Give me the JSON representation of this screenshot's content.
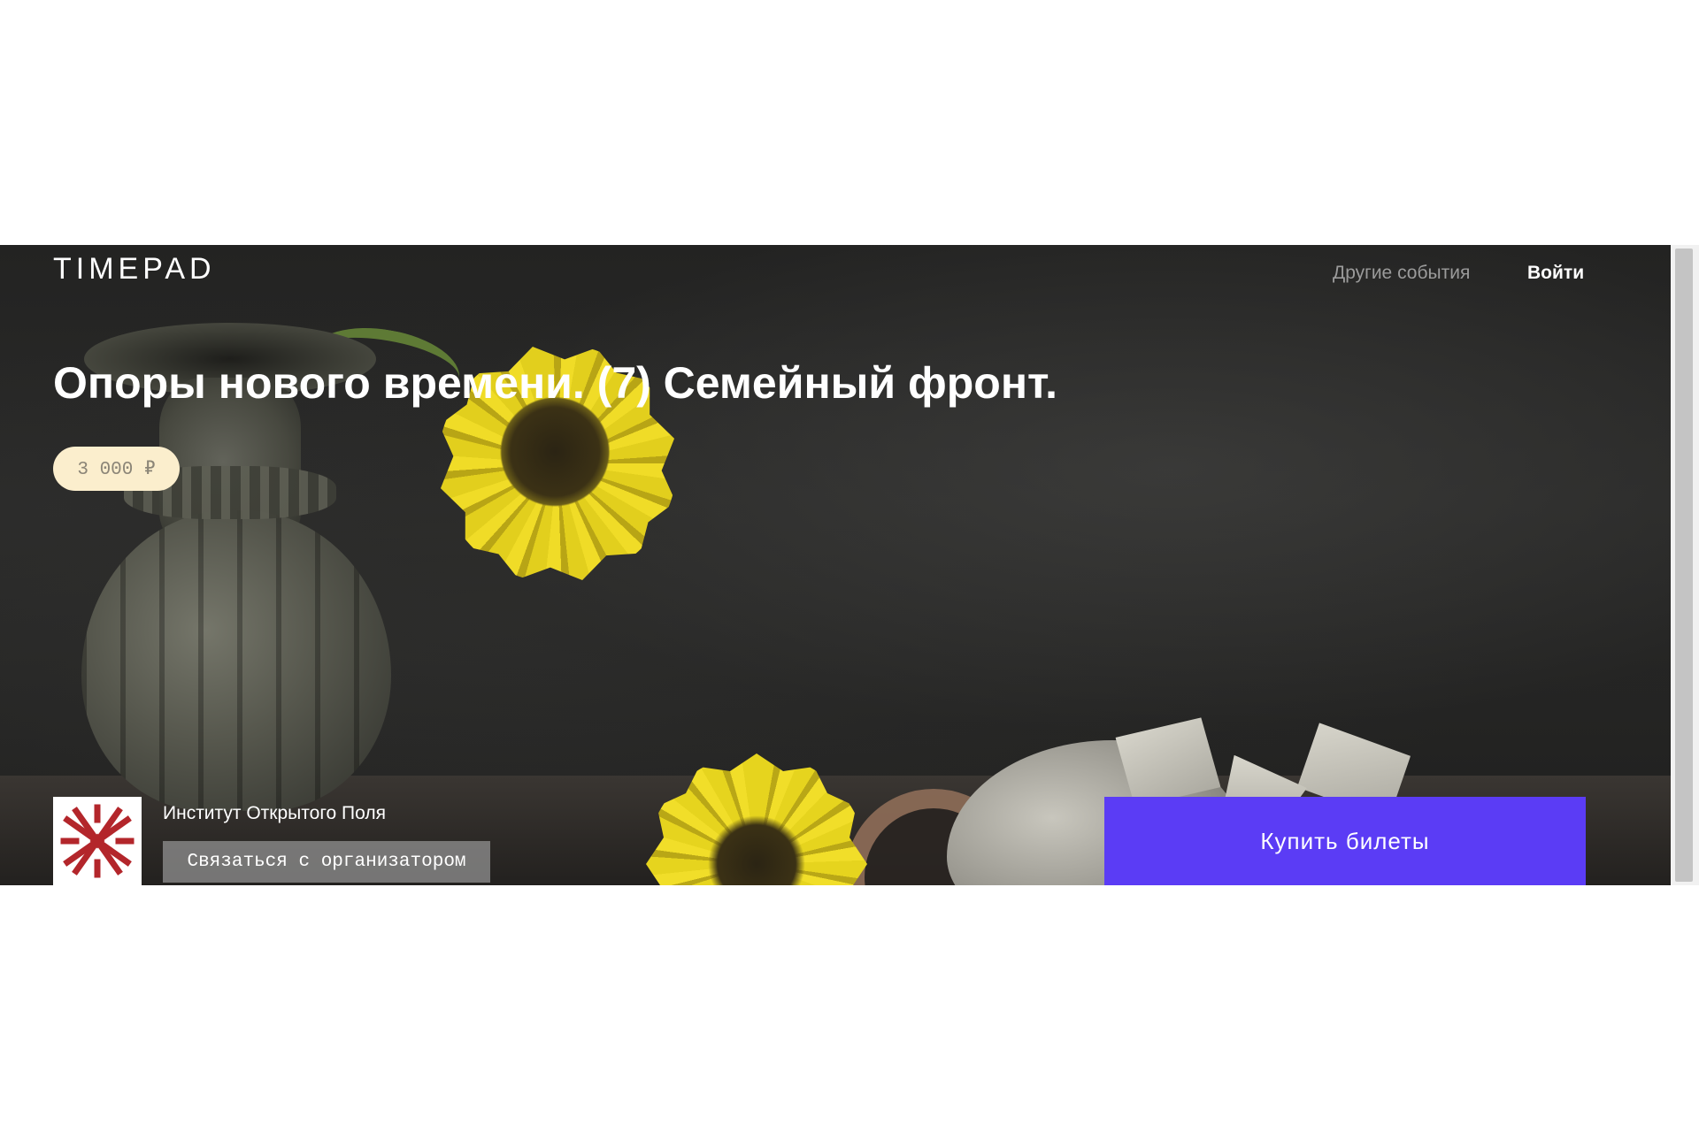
{
  "header": {
    "logo_text": "TIMEPAD",
    "nav": {
      "other_events": "Другие события",
      "login": "Войти"
    }
  },
  "event": {
    "title": "Опоры нового времени. (7) Семейный фронт.",
    "price": "3 000 ₽"
  },
  "organizer": {
    "name": "Институт Открытого Поля",
    "contact_label": "Связаться с организатором",
    "avatar_icon": "ornament-logo-icon"
  },
  "actions": {
    "buy_label": "Купить билеты"
  },
  "colors": {
    "accent": "#5b3cf5",
    "price_badge_bg": "#fbeecd",
    "hero_bg": "#232322",
    "organizer_logo": "#b3262b"
  }
}
